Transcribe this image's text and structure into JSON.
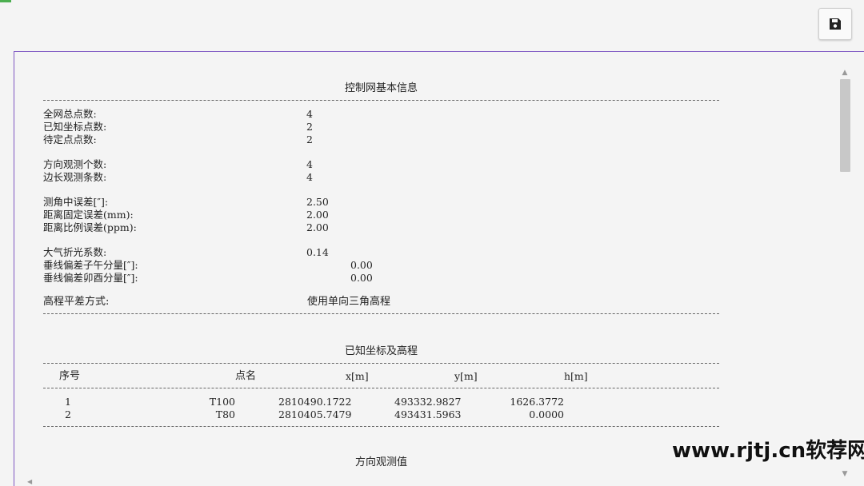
{
  "toolbar": {
    "save_icon": "floppy-disk-icon"
  },
  "sections": {
    "basic_info": {
      "title": "控制网基本信息",
      "rows": [
        {
          "label": "全网总点数:",
          "value": "4"
        },
        {
          "label": "已知坐标点数:",
          "value": "2"
        },
        {
          "label": "待定点点数:",
          "value": "2"
        },
        {
          "label": "方向观测个数:",
          "value": "4"
        },
        {
          "label": "边长观测条数:",
          "value": "4"
        },
        {
          "label": "测角中误差[″]:",
          "value": "2.50"
        },
        {
          "label": "距离固定误差(mm):",
          "value": "2.00"
        },
        {
          "label": "距离比例误差(ppm):",
          "value": "2.00"
        },
        {
          "label": "大气折光系数:",
          "value": "0.14"
        },
        {
          "label": "垂线偏差子午分量[″]:",
          "value": "0.00"
        },
        {
          "label": "垂线偏差卯酉分量[″]:",
          "value": "0.00"
        },
        {
          "label": "高程平差方式:",
          "value": "使用单向三角高程"
        }
      ]
    },
    "known_coords": {
      "title": "已知坐标及高程",
      "headers": [
        "序号",
        "点名",
        "x[m]",
        "y[m]",
        "h[m]"
      ],
      "rows": [
        [
          "1",
          "T100",
          "2810490.1722",
          "493332.9827",
          "1626.3772"
        ],
        [
          "2",
          "T80",
          "2810405.7479",
          "493431.5963",
          "0.0000"
        ]
      ]
    },
    "direction_obs": {
      "title": "方向观测值"
    }
  },
  "watermark": {
    "text": "www.rjtj.cn软荐网"
  }
}
